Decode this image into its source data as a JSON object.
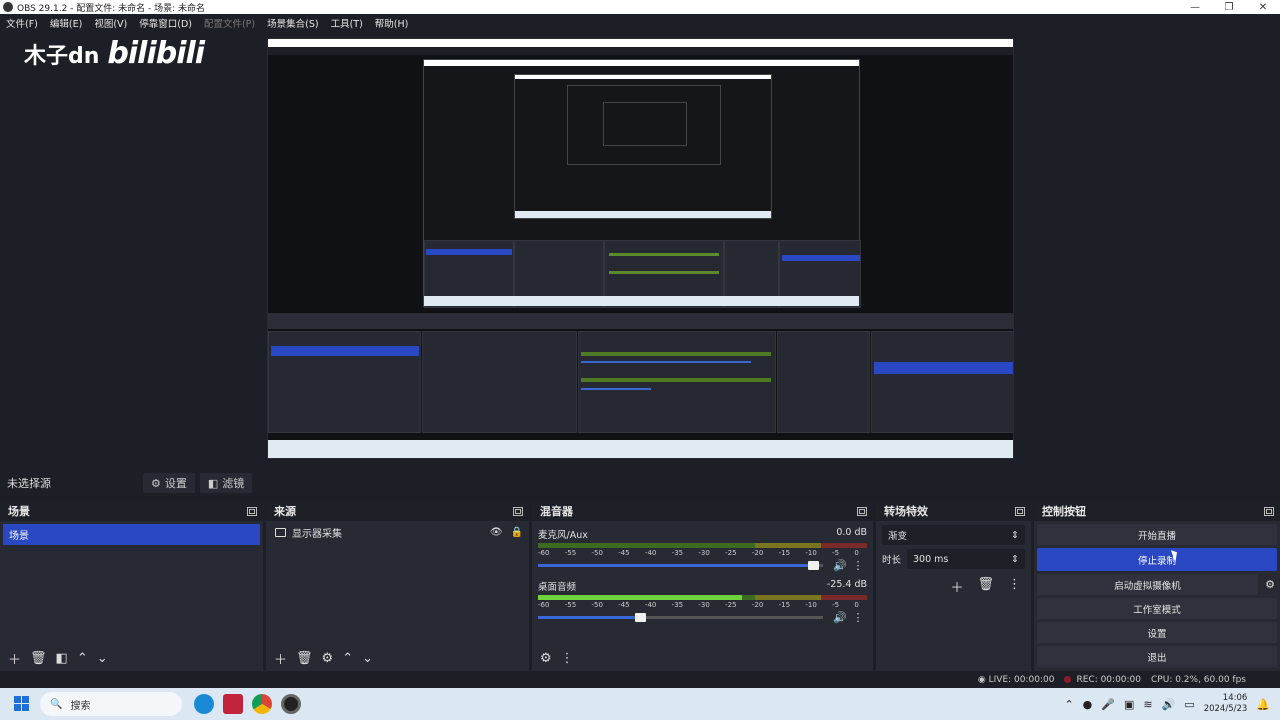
{
  "window": {
    "title": "OBS 29.1.2 - 配置文件: 未命名 - 场景: 未命名",
    "minimize": "—",
    "maximize": "❐",
    "close": "✕"
  },
  "menu": [
    "文件(F)",
    "编辑(E)",
    "视图(V)",
    "停靠窗口(D)",
    "配置文件(P)",
    "场景集合(S)",
    "工具(T)",
    "帮助(H)"
  ],
  "watermark": {
    "text": "木子dn",
    "brand": "bilibili"
  },
  "source_toolbar": {
    "no_selection": "未选择源",
    "properties": "设置",
    "filters": "滤镜"
  },
  "scenes": {
    "title": "场景",
    "items": [
      "场景"
    ]
  },
  "sources": {
    "title": "来源",
    "items": [
      "显示器采集"
    ]
  },
  "mixer": {
    "title": "混音器",
    "channels": [
      {
        "name": "麦克风/Aux",
        "db": "0.0 dB",
        "level": 0.0,
        "volume": 0.97
      },
      {
        "name": "桌面音频",
        "db": "-25.4 dB",
        "level": 0.62,
        "volume": 0.36
      }
    ],
    "ticks": [
      "-60",
      "-55",
      "-50",
      "-45",
      "-40",
      "-35",
      "-30",
      "-25",
      "-20",
      "-15",
      "-10",
      "-5",
      "0"
    ]
  },
  "transitions": {
    "title": "转场特效",
    "type": "渐变",
    "duration_label": "时长",
    "duration": "300 ms"
  },
  "controls": {
    "title": "控制按钮",
    "start_stream": "开始直播",
    "stop_record": "停止录制",
    "virtual_cam": "启动虚拟摄像机",
    "studio_mode": "工作室模式",
    "settings": "设置",
    "exit": "退出"
  },
  "status": {
    "live": "LIVE: 00:00:00",
    "rec": "REC: 00:00:00",
    "cpu": "CPU: 0.2%, 60.00 fps"
  },
  "taskbar": {
    "search_placeholder": "搜索",
    "time": "14:06",
    "date": "2024/5/23"
  },
  "colors": {
    "accent": "#2b48c4",
    "panel": "#272a33",
    "background": "#1d1f26"
  }
}
